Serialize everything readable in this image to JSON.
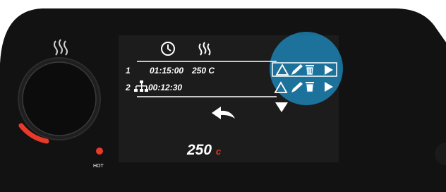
{
  "panel": {
    "hot_label": "HOT",
    "colors": {
      "hot_red": "#e8392a",
      "accent_blue": "#1d8fc6",
      "screen_bg": "#1c1c1c",
      "body_bg": "#121212"
    }
  },
  "screen": {
    "header_icons": [
      "clock-icon",
      "heat-waves-icon"
    ],
    "rows": [
      {
        "index": "1",
        "time": "01:15:00",
        "temp": "250 C",
        "icon": ""
      },
      {
        "index": "2",
        "time": "00:12:30",
        "temp": "",
        "icon": "sitemap-icon"
      }
    ],
    "row_actions": [
      "triangle-up-icon",
      "pencil-icon",
      "trash-icon",
      "play-icon"
    ],
    "scroll_down_icon": "triangle-down-icon",
    "back_icon": "back-arrow-icon",
    "current_temp": "250",
    "current_temp_unit": "c"
  }
}
